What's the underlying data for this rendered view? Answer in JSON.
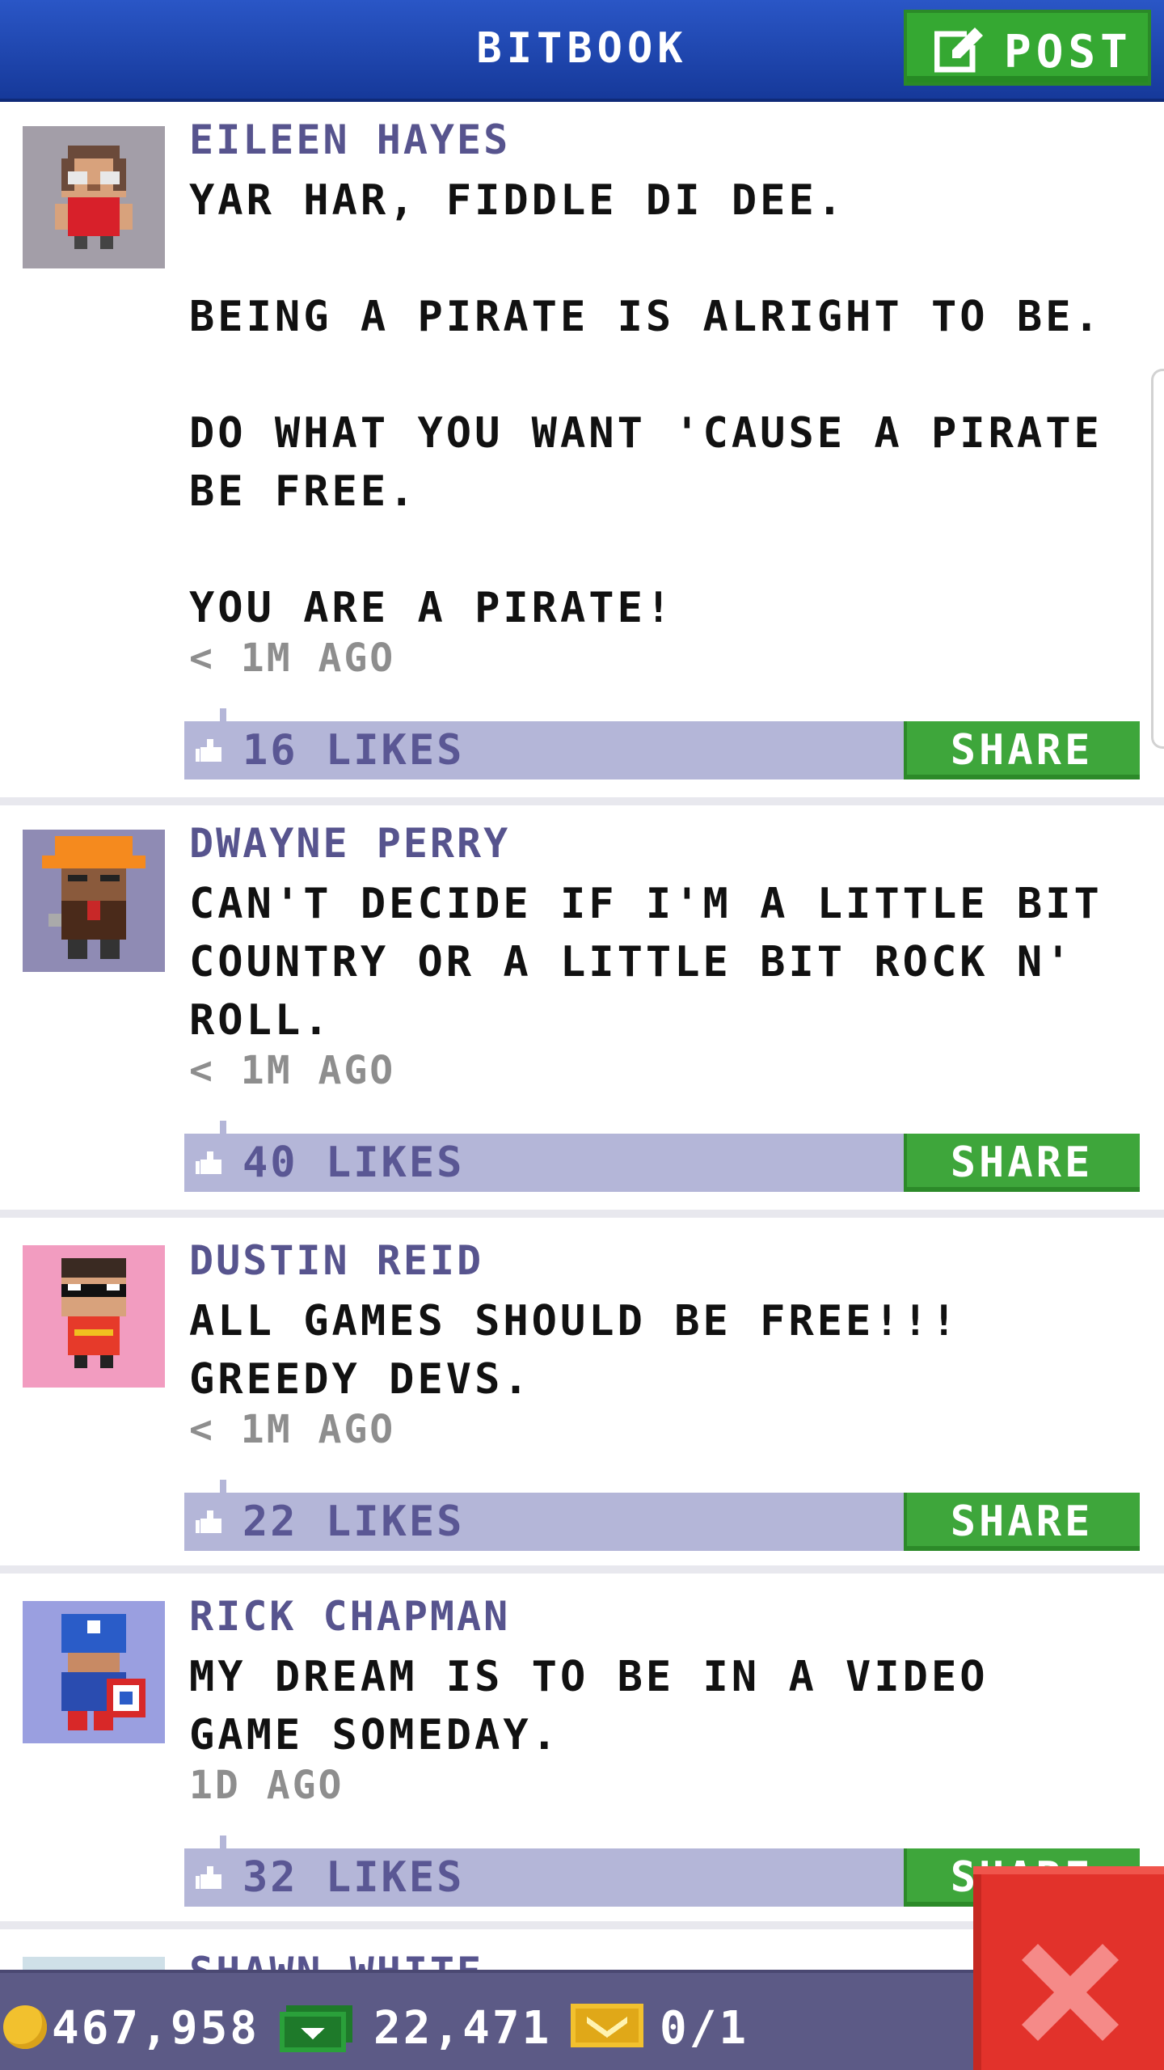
{
  "header": {
    "title": "BITBOOK",
    "post_label": "POST"
  },
  "posts": [
    {
      "author": "EILEEN HAYES",
      "text": "YAR HAR, FIDDLE DI DEE.\n\nBEING A PIRATE IS ALRIGHT TO BE.\n\nDO WHAT YOU WANT 'CAUSE A PIRATE BE FREE.\n\nYOU ARE A PIRATE!",
      "time": "< 1M AGO",
      "likes": "16 LIKES",
      "share": "SHARE",
      "avatar_bg": "#a39ea8"
    },
    {
      "author": "DWAYNE PERRY",
      "text": "CAN'T DECIDE IF I'M A LITTLE BIT COUNTRY OR A LITTLE BIT ROCK N' ROLL.",
      "time": "< 1M AGO",
      "likes": "40 LIKES",
      "share": "SHARE",
      "avatar_bg": "#8f8bb4"
    },
    {
      "author": "DUSTIN REID",
      "text": "ALL GAMES SHOULD BE FREE!!! GREEDY DEVS.",
      "time": "< 1M AGO",
      "likes": "22 LIKES",
      "share": "SHARE",
      "avatar_bg": "#f29cc0"
    },
    {
      "author": "RICK CHAPMAN",
      "text": "MY DREAM IS TO BE IN A VIDEO GAME SOMEDAY.",
      "time": "1D AGO",
      "likes": "32 LIKES",
      "share": "SHARE",
      "avatar_bg": "#9a9fe0"
    },
    {
      "author": "SHAWN WHITE"
    }
  ],
  "bottom_bar": {
    "coins": "467,958",
    "bux": "22,471",
    "tickets": "0/1"
  },
  "colors": {
    "header": "#1f48b4",
    "green": "#3ea63b",
    "like_bar": "#b4b6d8",
    "name": "#57548e",
    "close": "#e2322b"
  }
}
